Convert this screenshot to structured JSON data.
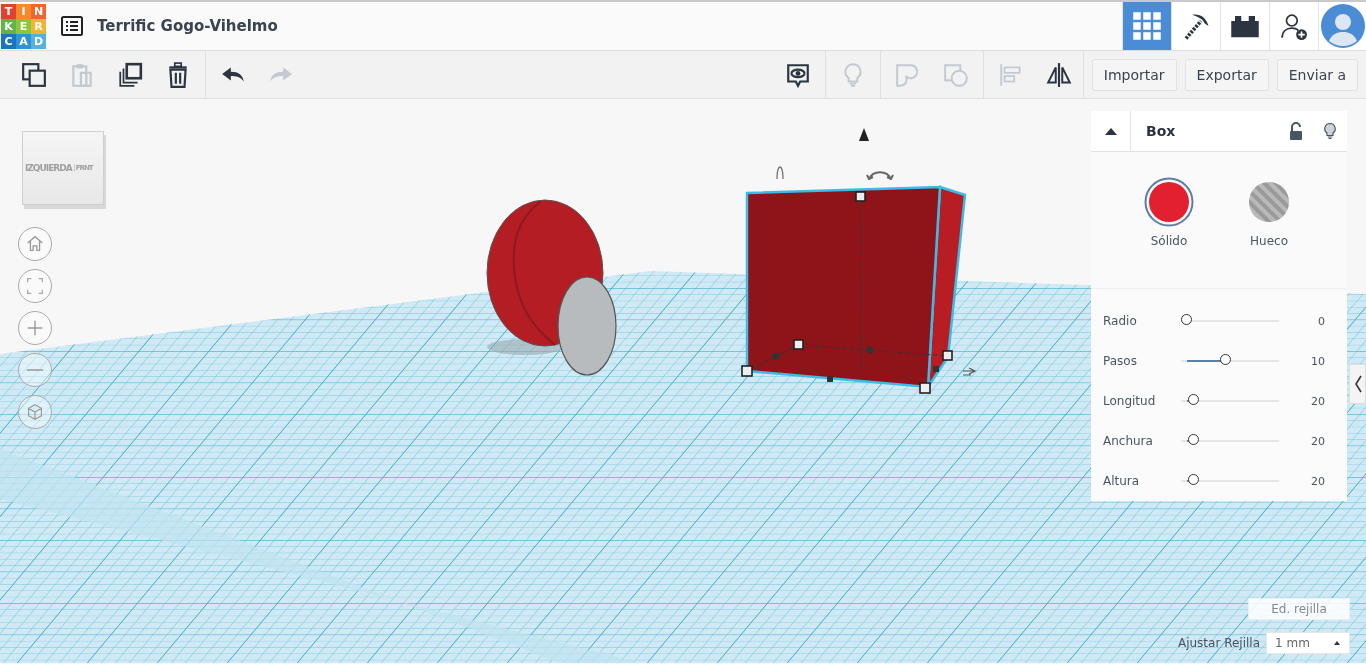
{
  "logo": {
    "letters": [
      {
        "char": "T",
        "color": "#e2412f"
      },
      {
        "char": "I",
        "color": "#f58a2a"
      },
      {
        "char": "N",
        "color": "#f0662e"
      },
      {
        "char": "K",
        "color": "#63b346"
      },
      {
        "char": "E",
        "color": "#8cc63f"
      },
      {
        "char": "R",
        "color": "#f2b530"
      },
      {
        "char": "C",
        "color": "#1b75bb"
      },
      {
        "char": "A",
        "color": "#2f93d1"
      },
      {
        "char": "D",
        "color": "#5ab0dd"
      }
    ]
  },
  "header": {
    "title": "Terrific Gogo-Vihelmo",
    "apps": [
      {
        "kind": "grid",
        "selected": true
      },
      {
        "kind": "pickaxe",
        "selected": false
      },
      {
        "kind": "brick",
        "selected": false
      }
    ]
  },
  "toolbar": {
    "left_tools": [
      {
        "kind": "copy",
        "disabled": false
      },
      {
        "kind": "paste",
        "disabled": true
      },
      {
        "kind": "duplicate",
        "disabled": false
      },
      {
        "kind": "delete",
        "disabled": false
      },
      {
        "kind": "sep"
      },
      {
        "kind": "undo",
        "disabled": false
      },
      {
        "kind": "redo",
        "disabled": true
      }
    ],
    "right_tools": [
      {
        "kind": "notes",
        "disabled": false
      },
      {
        "kind": "sep"
      },
      {
        "kind": "bulb",
        "disabled": true
      },
      {
        "kind": "sep"
      },
      {
        "kind": "group",
        "disabled": true
      },
      {
        "kind": "hole",
        "disabled": true
      },
      {
        "kind": "sep"
      },
      {
        "kind": "align",
        "disabled": true
      },
      {
        "kind": "mirror",
        "disabled": false
      }
    ],
    "buttons": [
      "Importar",
      "Exportar",
      "Enviar a"
    ]
  },
  "view_cube": {
    "left_face": "IZQUIERDA",
    "front_face": "FRNT"
  },
  "view_controls": [
    {
      "kind": "home"
    },
    {
      "kind": "fit"
    },
    {
      "kind": "zoom_in"
    },
    {
      "kind": "zoom_out"
    },
    {
      "kind": "ortho"
    }
  ],
  "inspector": {
    "title": "Box",
    "locked": false,
    "modes": [
      {
        "kind": "solid",
        "label": "Sólido",
        "selected": true
      },
      {
        "kind": "hole",
        "label": "Hueco",
        "selected": false
      }
    ],
    "params": [
      {
        "name": "Radio",
        "level": 0,
        "reading": "0"
      },
      {
        "name": "Pasos",
        "level": 0.45,
        "reading": "10"
      },
      {
        "name": "Longitud",
        "level": 0.08,
        "reading": "20"
      },
      {
        "name": "Anchura",
        "level": 0.08,
        "reading": "20"
      },
      {
        "name": "Altura",
        "level": 0.08,
        "reading": "20"
      }
    ]
  },
  "grid_controls": {
    "edit_button": "Ed. rejilla",
    "snap_label": "Ajustar Rejilla",
    "snap_value": "1 mm"
  }
}
